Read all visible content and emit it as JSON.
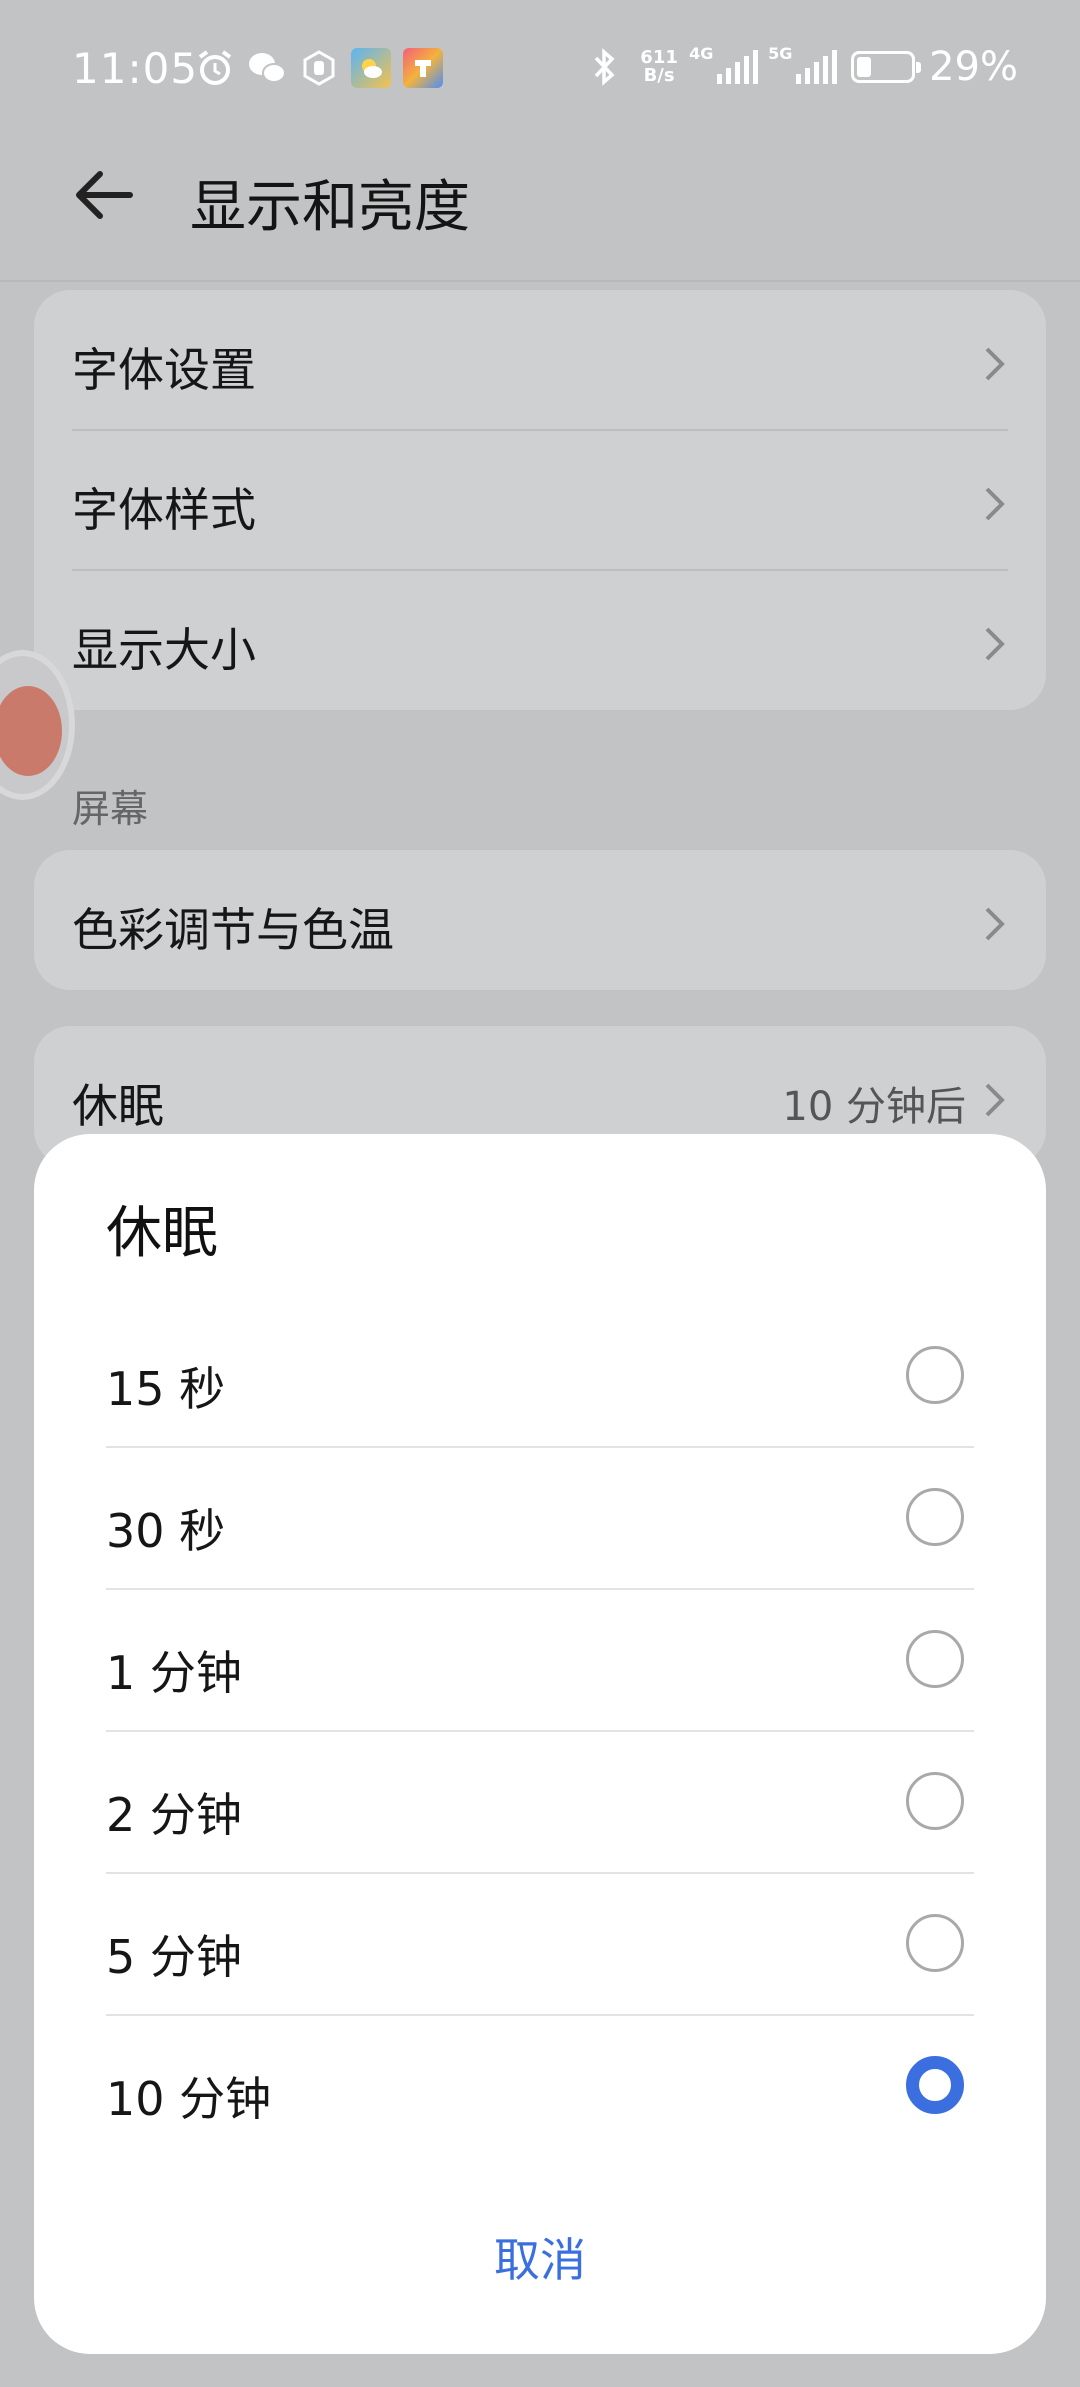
{
  "status_bar": {
    "time": "11:05",
    "net_speed_top": "611",
    "net_speed_bottom": "B/s",
    "sim1_label": "4G",
    "sim2_label": "5G",
    "battery_percent": "29%",
    "icons": [
      "alarm-icon",
      "wechat-icon",
      "shield-hand-icon",
      "weather-app-icon",
      "app-store-icon",
      "bluetooth-icon"
    ]
  },
  "header": {
    "title": "显示和亮度"
  },
  "font_card": {
    "items": [
      {
        "label": "字体设置"
      },
      {
        "label": "字体样式"
      },
      {
        "label": "显示大小"
      }
    ]
  },
  "screen_section": {
    "label": "屏幕",
    "items": [
      {
        "label": "色彩调节与色温"
      }
    ]
  },
  "sleep_row": {
    "label": "休眠",
    "value": "10 分钟后"
  },
  "dialog": {
    "title": "休眠",
    "options": [
      {
        "label": "15 秒",
        "selected": false
      },
      {
        "label": "30 秒",
        "selected": false
      },
      {
        "label": "1 分钟",
        "selected": false
      },
      {
        "label": "2 分钟",
        "selected": false
      },
      {
        "label": "5 分钟",
        "selected": false
      },
      {
        "label": "10 分钟",
        "selected": true
      }
    ],
    "cancel_label": "取消"
  },
  "colors": {
    "accent": "#3b6fe0",
    "scrim_background": "#c2c3c5",
    "card_background": "#cfd0d2",
    "dialog_background": "#ffffff"
  }
}
